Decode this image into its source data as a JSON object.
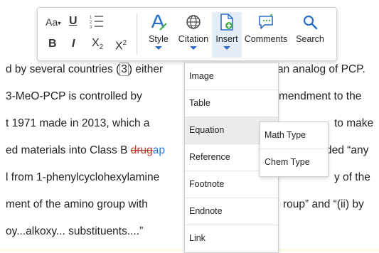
{
  "document": {
    "line1": {
      "a": "d by several countries (",
      "marker": "3",
      "b": ") either",
      "c": "an analog of PCP."
    },
    "line2": {
      "a": "3-MeO-PCP is controlled by",
      "c": "mendment to the"
    },
    "line3": {
      "a": "t 1971 made in 2013, which a",
      "c": "to make"
    },
    "line4": {
      "a": "ed materials into Class B ",
      "deleted": "drug",
      "inserted": "ap",
      "c": "ded “any"
    },
    "line5": {
      "a": "l from 1-phenylcyclohexylamine",
      "c": "y of the"
    },
    "line6": {
      "a": "ment of the amino group with",
      "c": "roup” and “(ii) by"
    },
    "line7": {
      "a": "oy...alkoxy... substituents....”"
    }
  },
  "toolbar": {
    "font_size": "Aa",
    "underline": "U",
    "bold": "B",
    "italic": "I",
    "subscript": {
      "base": "X",
      "sub": "2"
    },
    "superscript": {
      "base": "X",
      "sup": "2"
    },
    "style": {
      "label": "Style",
      "icon": "style-icon"
    },
    "citation": {
      "label": "Citation",
      "icon": "globe-icon"
    },
    "insert": {
      "label": "Insert",
      "icon": "insert-document-icon"
    },
    "comments": {
      "label": "Comments",
      "icon": "comment-icon"
    },
    "search": {
      "label": "Search",
      "icon": "search-icon"
    }
  },
  "insert_menu": {
    "items": [
      "Image",
      "Table",
      "Equation",
      "Reference",
      "Footnote",
      "Endnote",
      "Link"
    ],
    "hovered": "Equation"
  },
  "equation_submenu": {
    "items": [
      "Math Type",
      "Chem Type"
    ]
  },
  "colors": {
    "accent": "#2a6fcb",
    "deleted": "#c0392b",
    "inserted": "#2a7bd6",
    "icon_green": "#4caf50"
  }
}
